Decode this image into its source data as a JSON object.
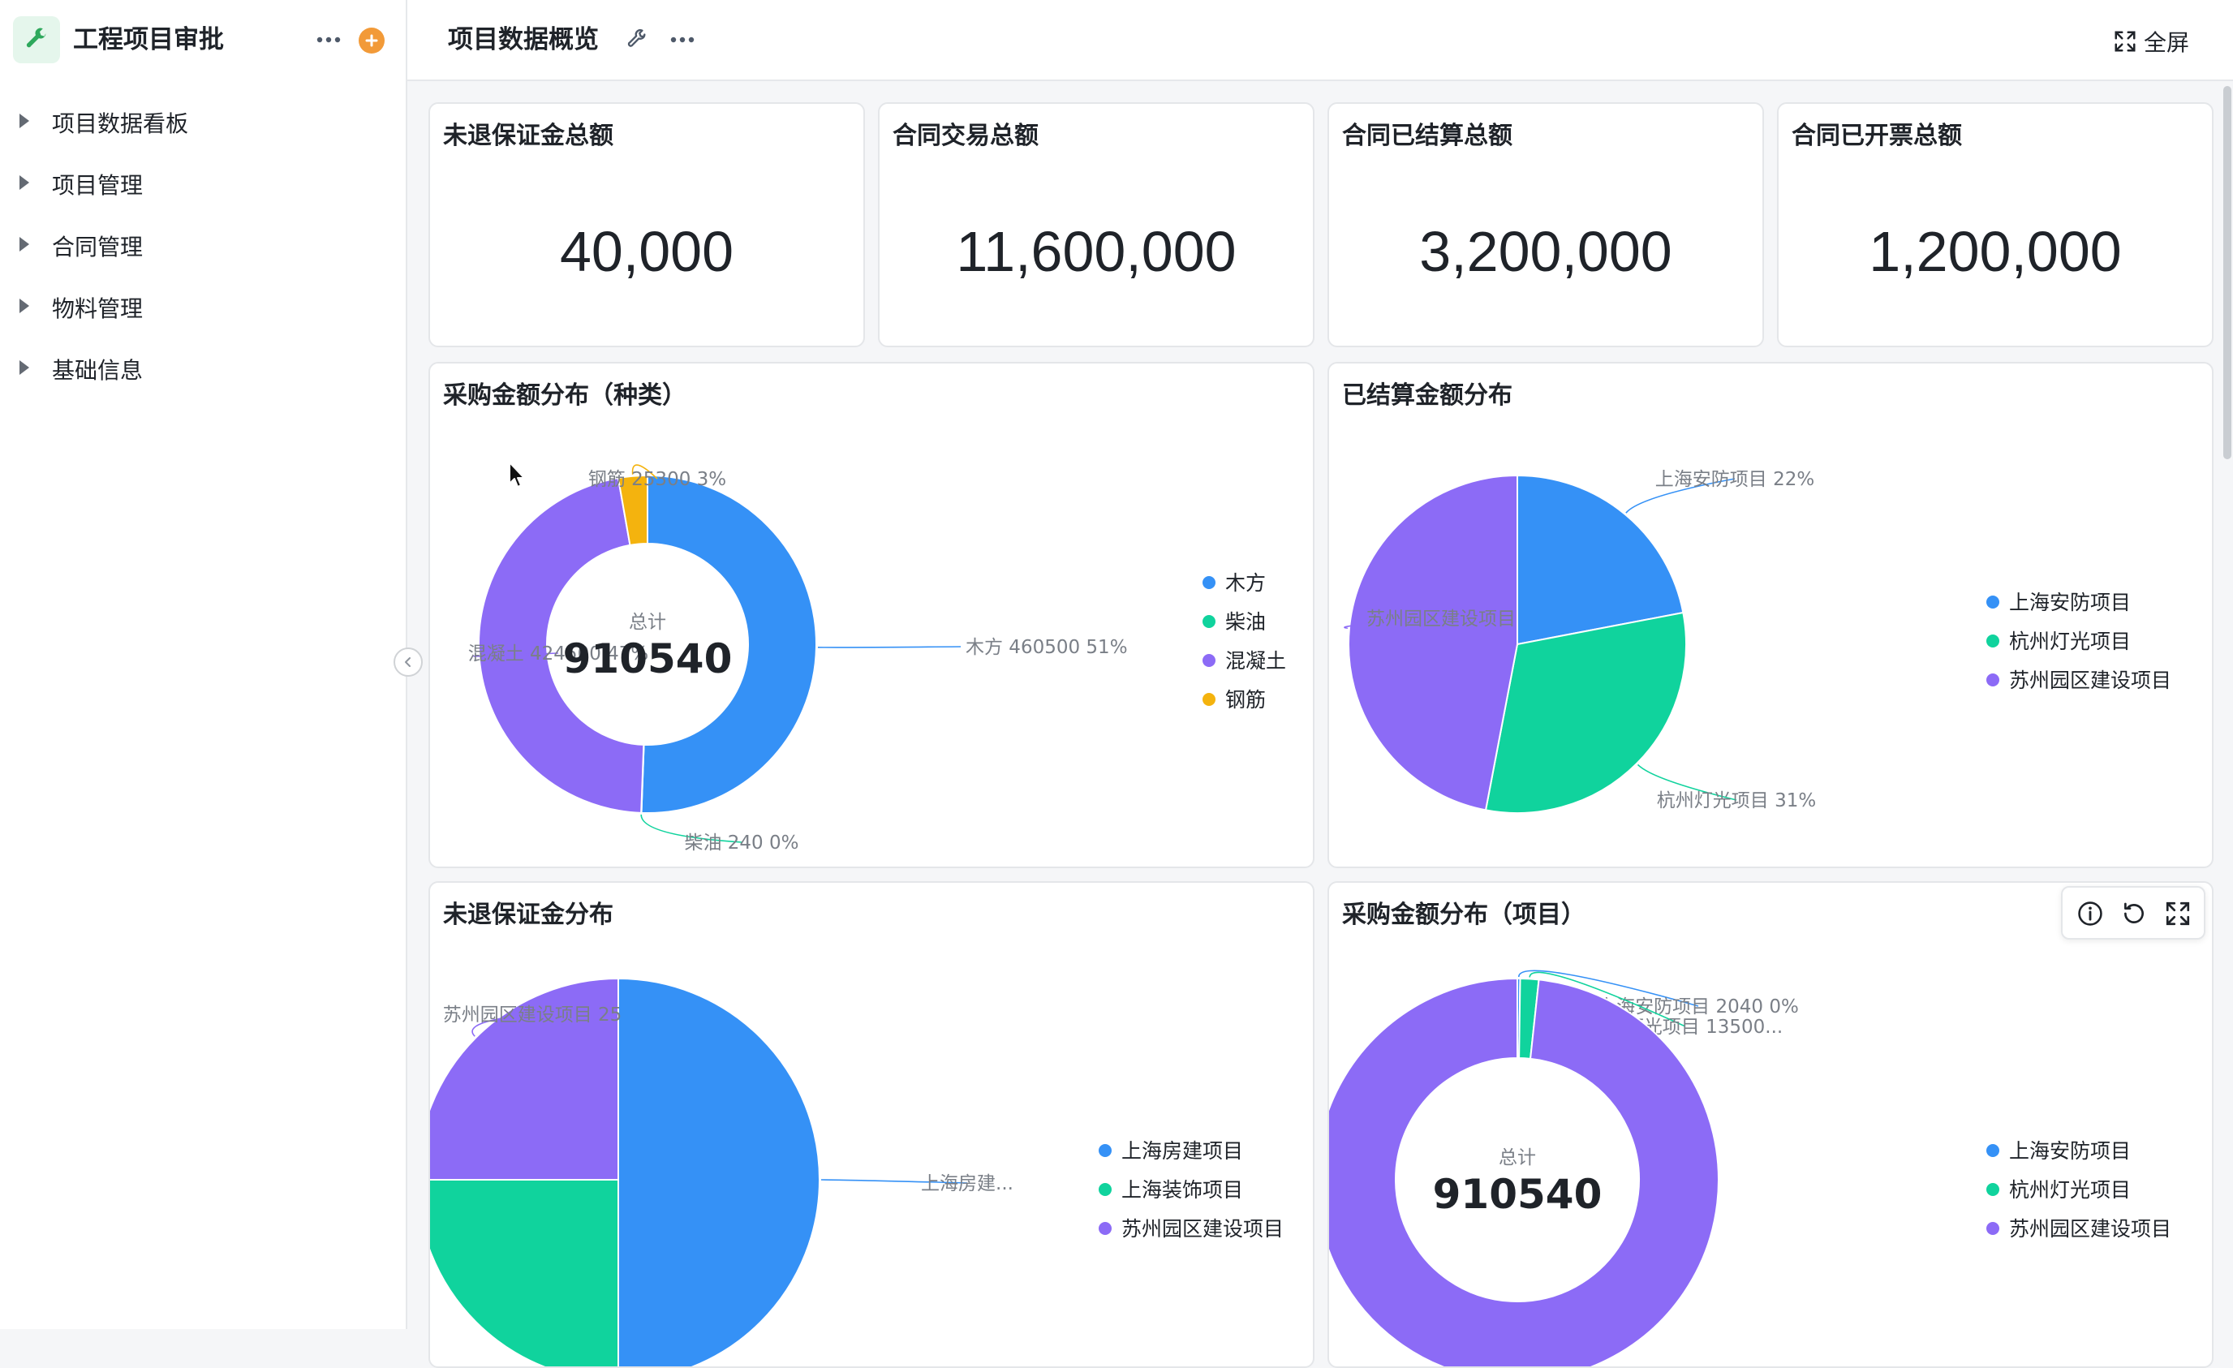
{
  "app": {
    "title": "工程项目审批",
    "accent": "#2ea85c",
    "add_color": "#f29a38"
  },
  "sidebar": {
    "items": [
      {
        "label": "项目数据看板"
      },
      {
        "label": "项目管理"
      },
      {
        "label": "合同管理"
      },
      {
        "label": "物料管理"
      },
      {
        "label": "基础信息"
      }
    ]
  },
  "header": {
    "title": "项目数据概览",
    "fullscreen_label": "全屏"
  },
  "stats": [
    {
      "title": "未退保证金总额",
      "value": "40,000"
    },
    {
      "title": "合同交易总额",
      "value": "11,600,000"
    },
    {
      "title": "合同已结算总额",
      "value": "3,200,000"
    },
    {
      "title": "合同已开票总额",
      "value": "1,200,000"
    }
  ],
  "chart_data": [
    {
      "type": "pie",
      "variant": "donut",
      "title": "采购金额分布（种类）",
      "center_label": "总计",
      "center_value": "910540",
      "slices": [
        {
          "name": "木方",
          "value": 460500,
          "label": "木方 460500 51%",
          "color": "#3591f6"
        },
        {
          "name": "柴油",
          "value": 240,
          "label": "柴油 240 0%",
          "color": "#10d39d"
        },
        {
          "name": "混凝土",
          "value": 424500,
          "label": "混凝土 424500 47%",
          "color": "#8c6bf6"
        },
        {
          "name": "钢筋",
          "value": 25300,
          "label": "钢筋 25300 3%",
          "color": "#f4b30e"
        }
      ],
      "legend": [
        "木方",
        "柴油",
        "混凝土",
        "钢筋"
      ],
      "legend_position": "right"
    },
    {
      "type": "pie",
      "title": "已结算金额分布",
      "slices": [
        {
          "name": "上海安防项目",
          "value": 22,
          "label": "上海安防项目 22%",
          "color": "#3591f6"
        },
        {
          "name": "杭州灯光项目",
          "value": 31,
          "label": "杭州灯光项目 31%",
          "color": "#10d39d"
        },
        {
          "name": "苏州园区建设项目",
          "value": 47,
          "label": "苏州园区建设项目",
          "color": "#8c6bf6"
        }
      ],
      "legend": [
        "上海安防项目",
        "杭州灯光项目",
        "苏州园区建设项目"
      ],
      "legend_position": "right"
    },
    {
      "type": "pie",
      "title": "未退保证金分布",
      "slices": [
        {
          "name": "上海房建项目",
          "value": 50,
          "label": "上海房建...",
          "color": "#3591f6"
        },
        {
          "name": "上海装饰项目",
          "value": 25,
          "label": "",
          "color": "#10d39d"
        },
        {
          "name": "苏州园区建设项目",
          "value": 25,
          "label": "苏州园区建设项目 25",
          "color": "#8c6bf6"
        }
      ],
      "legend": [
        "上海房建项目",
        "上海装饰项目",
        "苏州园区建设项目"
      ],
      "legend_position": "right"
    },
    {
      "type": "pie",
      "variant": "donut",
      "title": "采购金额分布（项目）",
      "center_label": "总计",
      "center_value": "910540",
      "slices": [
        {
          "name": "上海安防项目",
          "value": 2040,
          "label": "上海安防项目 2040 0%",
          "color": "#3591f6"
        },
        {
          "name": "杭州灯光项目",
          "value": 13500,
          "label": "杭州灯光项目 13500...",
          "color": "#10d39d"
        },
        {
          "name": "苏州园区建设项目",
          "value": 895000,
          "label": "",
          "color": "#8c6bf6"
        }
      ],
      "legend": [
        "上海安防项目",
        "杭州灯光项目",
        "苏州园区建设项目"
      ],
      "legend_position": "right"
    }
  ]
}
